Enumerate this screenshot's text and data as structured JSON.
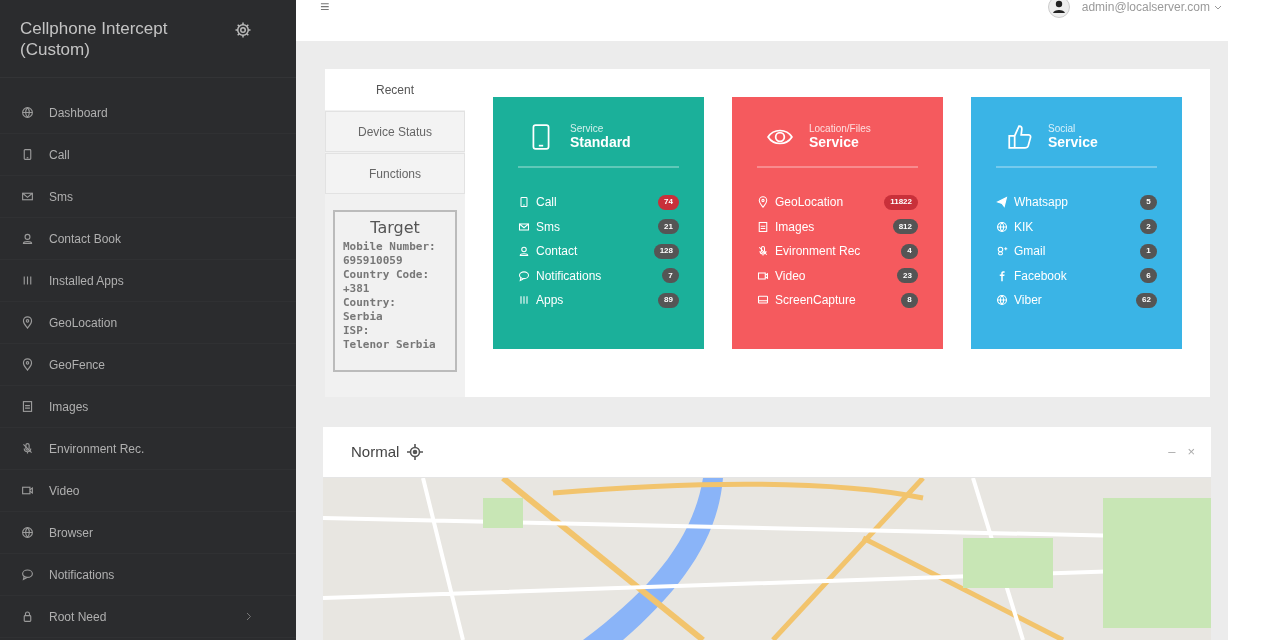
{
  "sidebar": {
    "title": "Cellphone Intercept (Custom)",
    "items": [
      {
        "label": "Dashboard",
        "kind": "globe",
        "expandable": false
      },
      {
        "label": "Call",
        "kind": "phone",
        "expandable": false
      },
      {
        "label": "Sms",
        "kind": "envelope",
        "expandable": false
      },
      {
        "label": "Contact Book",
        "kind": "user",
        "expandable": false
      },
      {
        "label": "Installed Apps",
        "kind": "grid",
        "expandable": false
      },
      {
        "label": "GeoLocation",
        "kind": "pin",
        "expandable": false
      },
      {
        "label": "GeoFence",
        "kind": "pin",
        "expandable": false
      },
      {
        "label": "Images",
        "kind": "image",
        "expandable": false
      },
      {
        "label": "Environment Rec.",
        "kind": "mic",
        "expandable": false
      },
      {
        "label": "Video",
        "kind": "video",
        "expandable": false
      },
      {
        "label": "Browser",
        "kind": "globe",
        "expandable": false
      },
      {
        "label": "Notifications",
        "kind": "bubble",
        "expandable": false
      },
      {
        "label": "Root Need",
        "kind": "lock",
        "expandable": true
      }
    ]
  },
  "header": {
    "menu_glyph": "≡",
    "user": "admin@localserver.com"
  },
  "tabs": [
    {
      "label": "Recent",
      "selected": true
    },
    {
      "label": "Device Status",
      "selected": false
    },
    {
      "label": "Functions",
      "selected": false
    }
  ],
  "target": {
    "title": "Target",
    "lines": [
      "Mobile Number:",
      "695910059",
      "Country Code:",
      "+381",
      "Country:",
      "Serbia",
      "ISP:",
      "Telenor Serbia"
    ]
  },
  "cards": [
    {
      "kind": "phone",
      "color": "#1bb09a",
      "subtitle": "Service",
      "title": "Standard",
      "rows": [
        {
          "kind": "phone",
          "label": "Call",
          "count": "74",
          "alert": true
        },
        {
          "kind": "envelope",
          "label": "Sms",
          "count": "21",
          "alert": false
        },
        {
          "kind": "user",
          "label": "Contact",
          "count": "128",
          "alert": false
        },
        {
          "kind": "bubble",
          "label": "Notifications",
          "count": "7",
          "alert": false
        },
        {
          "kind": "grid",
          "label": "Apps",
          "count": "89",
          "alert": false
        }
      ]
    },
    {
      "kind": "eye",
      "color": "#f55a5e",
      "subtitle": "Location/Files",
      "title": "Service",
      "rows": [
        {
          "kind": "pin",
          "label": "GeoLocation",
          "count": "11822",
          "alert": true
        },
        {
          "kind": "image",
          "label": "Images",
          "count": "812",
          "alert": false
        },
        {
          "kind": "mic",
          "label": "Evironment Rec",
          "count": "4",
          "alert": false
        },
        {
          "kind": "video",
          "label": "Video",
          "count": "23",
          "alert": false
        },
        {
          "kind": "screen",
          "label": "ScreenCapture",
          "count": "8",
          "alert": false
        }
      ]
    },
    {
      "kind": "thumb",
      "color": "#3ab4e6",
      "subtitle": "Social",
      "title": "Service",
      "rows": [
        {
          "kind": "send",
          "label": "Whatsapp",
          "count": "5",
          "alert": false
        },
        {
          "kind": "globe",
          "label": "KIK",
          "count": "2",
          "alert": false
        },
        {
          "kind": "gplus",
          "label": "Gmail",
          "count": "1",
          "alert": false
        },
        {
          "kind": "fb",
          "label": "Facebook",
          "count": "6",
          "alert": false
        },
        {
          "kind": "globe",
          "label": "Viber",
          "count": "62",
          "alert": false
        }
      ]
    }
  ],
  "map_panel": {
    "title": "Normal",
    "minimize": "–",
    "close": "×"
  }
}
